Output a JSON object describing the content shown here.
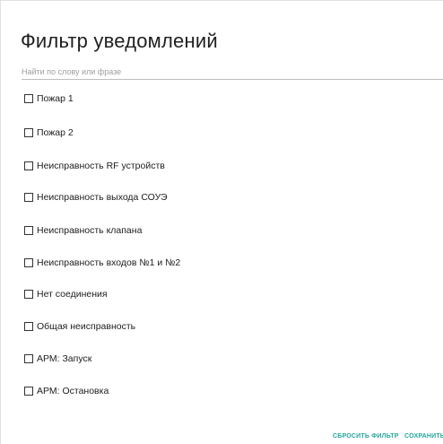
{
  "dialog": {
    "title": "Фильтр уведомлений",
    "search": {
      "placeholder": "Найти по слову или фразе",
      "value": ""
    },
    "items": [
      {
        "label": "Пожар 1",
        "checked": false
      },
      {
        "label": "Пожар 2",
        "checked": false
      },
      {
        "label": "Неисправность RF устройств",
        "checked": false
      },
      {
        "label": "Неисправность выхода СОУЭ",
        "checked": false
      },
      {
        "label": "Неисправность клапана",
        "checked": false
      },
      {
        "label": "Неисправность входов №1 и №2",
        "checked": false
      },
      {
        "label": "Нет соединения",
        "checked": false
      },
      {
        "label": "Общая неисправность",
        "checked": false
      },
      {
        "label": "АРМ: Запуск",
        "checked": false
      },
      {
        "label": "АРМ: Остановка",
        "checked": false
      }
    ],
    "actions": {
      "reset_label": "СБРОСИТЬ ФИЛЬТР",
      "save_label": "СОХРАНИТЬ"
    }
  },
  "colors": {
    "accent": "#26a69a",
    "text": "#212121",
    "placeholder": "#9e9e9e"
  }
}
